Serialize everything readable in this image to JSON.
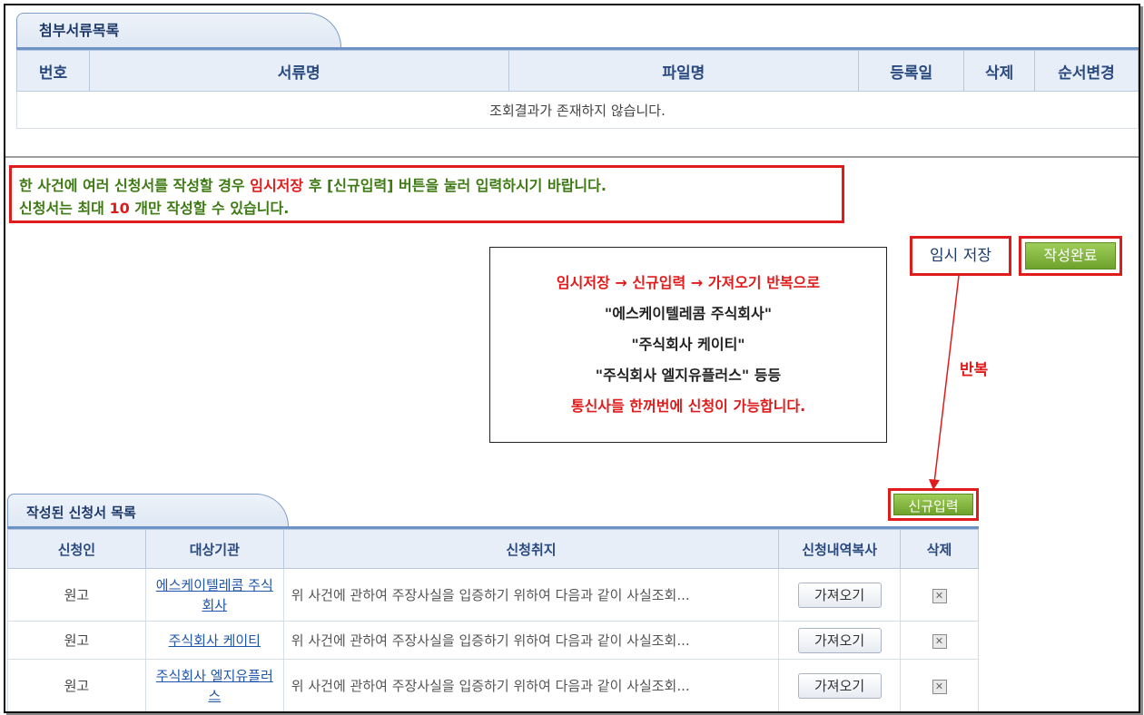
{
  "attachments": {
    "title": "첨부서류목록",
    "columns": [
      "번호",
      "서류명",
      "파일명",
      "등록일",
      "삭제",
      "순서변경"
    ],
    "empty_message": "조회결과가 존재하지 않습니다."
  },
  "notice": {
    "line1_a": "한 사건에 여러 신청서를 작성할 경우 ",
    "line1_b": "임시저장",
    "line1_c": " 후 [신규입력] 버튼을 눌러 입력하시기 바랍니다.",
    "line2_a": "신청서는 최대 ",
    "line2_b": "10",
    "line2_c": " 개만 작성할 수 있습니다."
  },
  "buttons": {
    "temp_save": "임시 저장",
    "complete": "작성완료",
    "new_input": "신규입력"
  },
  "callout": {
    "line1": "임시저장 → 신규입력 → 가져오기 반복으로",
    "line2": "\"에스케이텔레콤 주식회사\"",
    "line3": "\"주식회사 케이티\"",
    "line4": "\"주식회사 엘지유플러스\" 등등",
    "line5": "통신사들 한꺼번에 신청이 가능합니다.",
    "repeat": "반복"
  },
  "applications": {
    "title": "작성된 신청서 목록",
    "columns": [
      "신청인",
      "대상기관",
      "신청취지",
      "신청내역복사",
      "삭제"
    ],
    "fetch_label": "가져오기",
    "rows": [
      {
        "applicant": "원고",
        "org": "에스케이텔레콤 주식회사",
        "reason": "위 사건에 관하여 주장사실을 입증하기 위하여 다음과 같이 사실조회..."
      },
      {
        "applicant": "원고",
        "org": "주식회사 케이티",
        "reason": "위 사건에 관하여 주장사실을 입증하기 위하여 다음과 같이 사실조회..."
      },
      {
        "applicant": "원고",
        "org": "주식회사 엘지유플러스",
        "reason": "위 사건에 관하여 주장사실을 입증하기 위하여 다음과 같이 사실조회..."
      }
    ]
  }
}
